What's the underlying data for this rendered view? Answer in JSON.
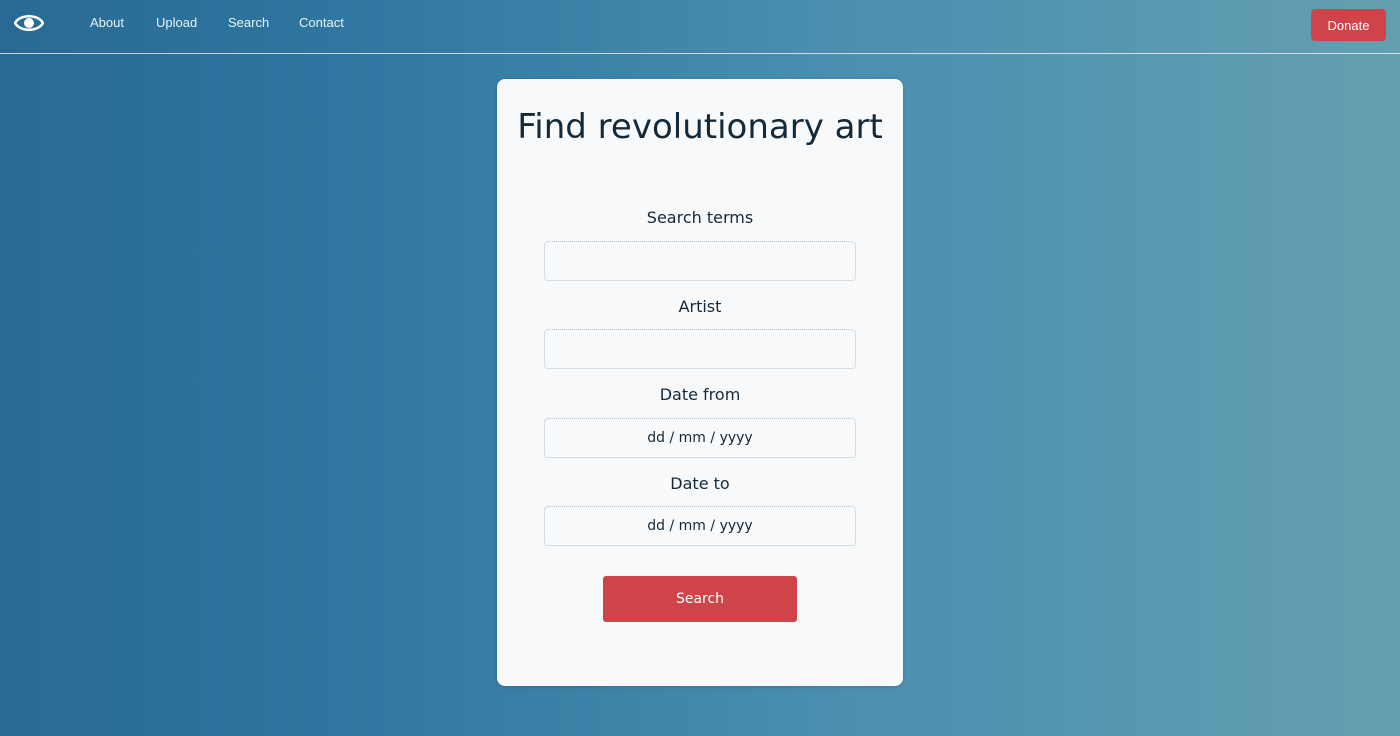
{
  "nav": {
    "logo_icon": "eye-icon",
    "links": [
      "About",
      "Upload",
      "Search",
      "Contact"
    ],
    "donate_label": "Donate"
  },
  "form": {
    "title": "Find revolutionary art",
    "search_terms_label": "Search terms",
    "artist_label": "Artist",
    "date_from_label": "Date from",
    "date_from_placeholder": "dd / mm / yyyy",
    "date_to_label": "Date to",
    "date_to_placeholder": "dd / mm / yyyy",
    "search_button_label": "Search"
  },
  "colors": {
    "accent": "#cf4448",
    "heading": "#14293a",
    "card": "#f7f9fa"
  }
}
